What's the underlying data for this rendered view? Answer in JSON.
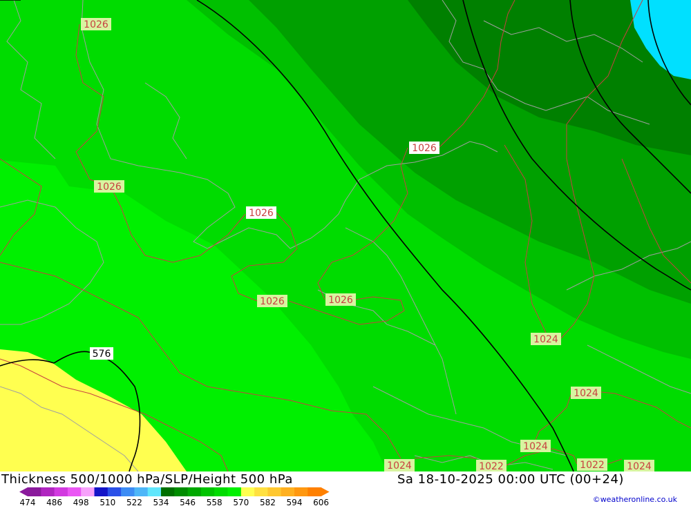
{
  "footer": {
    "title": "Thickness 500/1000 hPa/SLP/Height 500 hPa",
    "datetime": "Sa 18-10-2025 00:00 UTC (00+24)",
    "credit": "©weatheronline.co.uk"
  },
  "legend": {
    "ticks": [
      "474",
      "486",
      "498",
      "510",
      "522",
      "534",
      "546",
      "558",
      "570",
      "582",
      "594",
      "606"
    ],
    "swatches": [
      "#8a1a9c",
      "#b026c0",
      "#d23ae0",
      "#ea56f4",
      "#f7a2fb",
      "#1414c8",
      "#2a50e8",
      "#3c8cf4",
      "#4eb6f8",
      "#60e6fc",
      "#007000",
      "#008c00",
      "#00a800",
      "#00c400",
      "#00dc00",
      "#00f000",
      "#ffff50",
      "#ffe040",
      "#ffc830",
      "#ffb020",
      "#ff9810",
      "#ff8000"
    ]
  },
  "colors": {
    "band_546": "#00dc00",
    "band_540": "#00c000",
    "band_534": "#00a000",
    "band_528": "#008000",
    "band_522": "#00e0ff",
    "band_552": "#00f000",
    "band_558": "#ffff50",
    "isobar": "#c84040",
    "height_contour": "#000000",
    "coastline": "#a0a0a0"
  },
  "map_labels": {
    "isobars": [
      "1026",
      "1026",
      "1026",
      "1026",
      "1026",
      "1026",
      "1024",
      "1024",
      "1024",
      "1024",
      "1022",
      "1022",
      "1024"
    ],
    "height": [
      "576"
    ]
  }
}
